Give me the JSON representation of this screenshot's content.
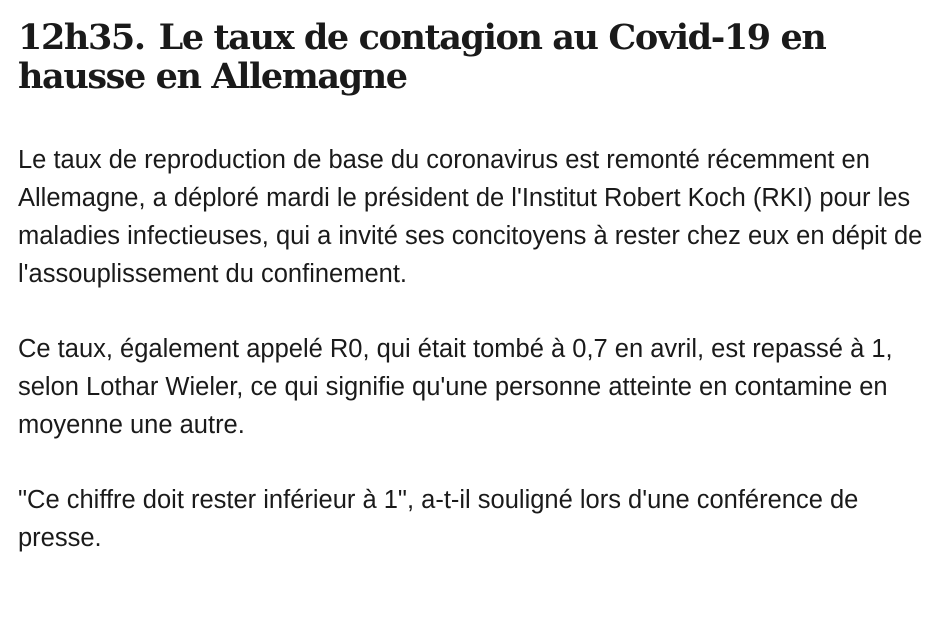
{
  "article": {
    "time": "12h35.",
    "title": "Le taux de contagion au Covid-19 en hausse en Allemagne",
    "paragraphs": [
      "Le taux de reproduction de base du coronavirus est remonté récemment en Allemagne, a déploré mardi le président de l'Institut Robert Koch (RKI) pour les maladies infectieuses, qui a invité ses concitoyens à rester chez eux en dépit de l'assouplissement du confinement.",
      "Ce taux, également appelé R0, qui était tombé à 0,7 en avril, est repassé à 1, selon Lothar Wieler, ce qui signifie qu'une personne atteinte en contamine en moyenne une autre.",
      "\"Ce chiffre doit rester inférieur à 1\", a-t-il souligné lors d'une conférence de presse."
    ]
  }
}
